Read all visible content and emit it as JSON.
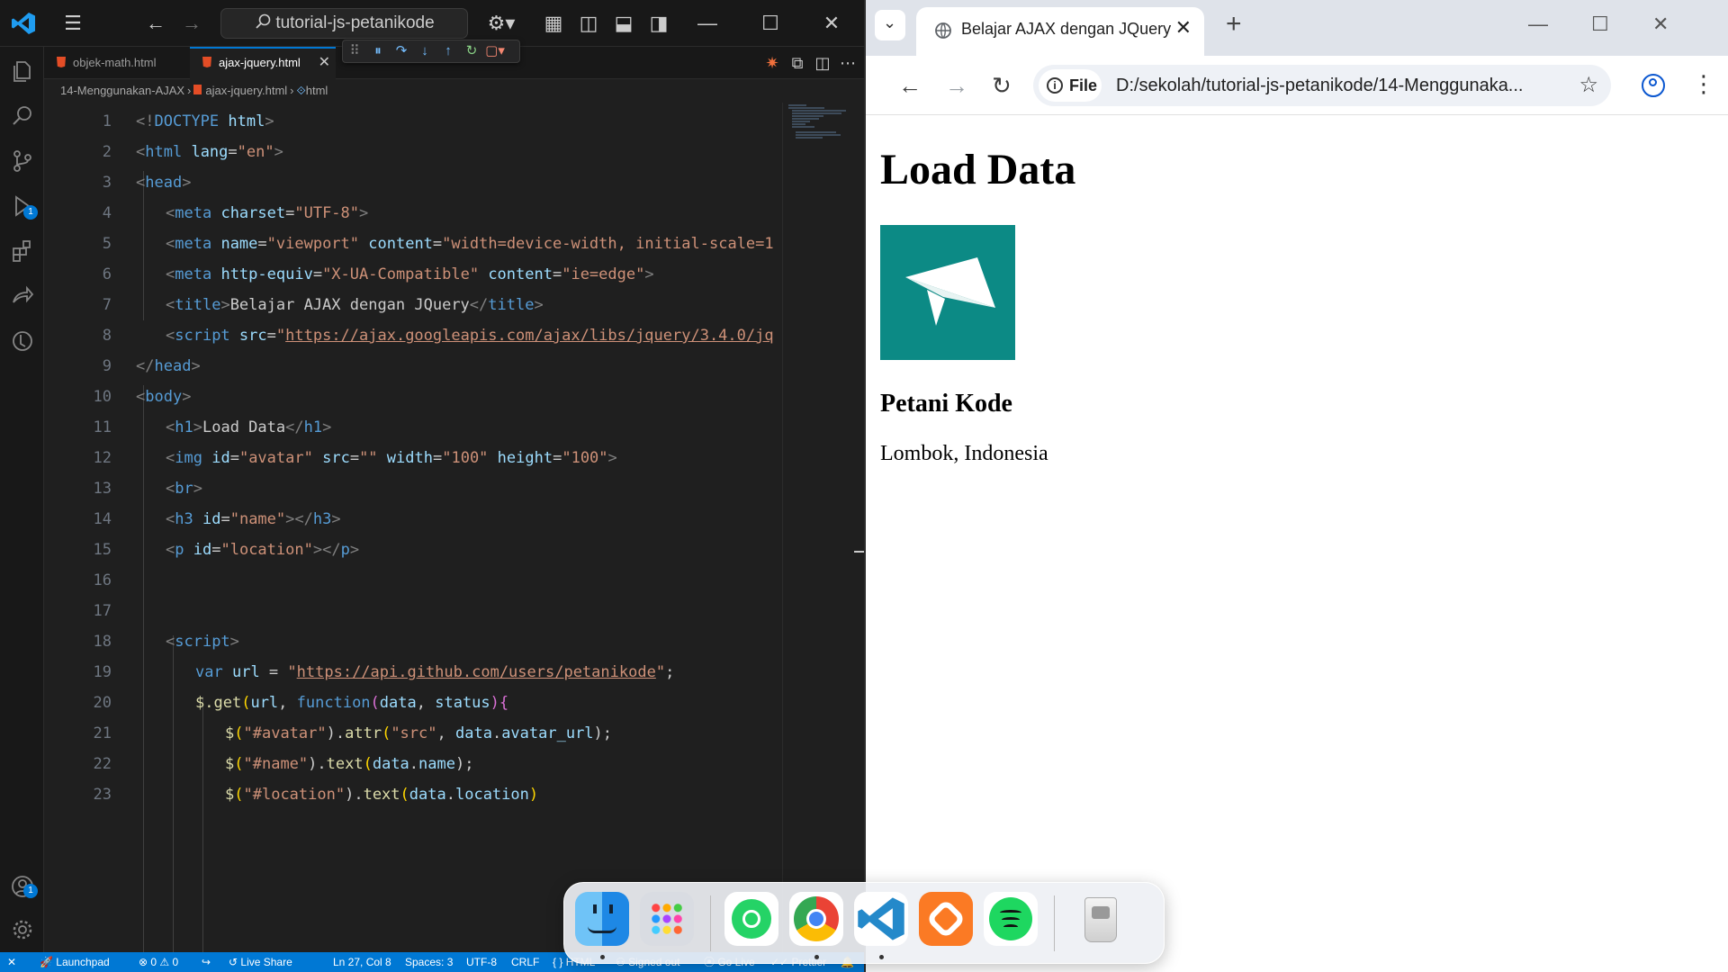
{
  "vscode": {
    "search_text": "tutorial-js-petanikode",
    "tabs": [
      {
        "label": "objek-math.html",
        "active": false
      },
      {
        "label": "ajax-jquery.html",
        "active": true
      }
    ],
    "breadcrumb": [
      "14-Menggunakan-AJAX",
      "ajax-jquery.html",
      "html"
    ],
    "activity_badges": {
      "run": "1",
      "accounts": "1"
    },
    "code_lines": [
      {
        "n": "1"
      },
      {
        "n": "2"
      },
      {
        "n": "3"
      },
      {
        "n": "4"
      },
      {
        "n": "5"
      },
      {
        "n": "6"
      },
      {
        "n": "7"
      },
      {
        "n": "8"
      },
      {
        "n": "9"
      },
      {
        "n": "10"
      },
      {
        "n": "11"
      },
      {
        "n": "12"
      },
      {
        "n": "13"
      },
      {
        "n": "14"
      },
      {
        "n": "15"
      },
      {
        "n": "16"
      },
      {
        "n": "17"
      },
      {
        "n": "18"
      },
      {
        "n": "19"
      },
      {
        "n": "20"
      },
      {
        "n": "21"
      },
      {
        "n": "22"
      },
      {
        "n": "23"
      }
    ],
    "code": {
      "l1": {
        "a": "<!",
        "b": "DOCTYPE",
        "c": "html",
        "d": ">"
      },
      "l2": {
        "a": "<",
        "b": "html",
        "c": "lang",
        "d": "=",
        "e": "\"en\"",
        "f": ">"
      },
      "l3": {
        "a": "<",
        "b": "head",
        "c": ">"
      },
      "l4": {
        "a": "<",
        "b": "meta",
        "c": "charset",
        "d": "=",
        "e": "\"UTF-8\"",
        "f": ">"
      },
      "l5": {
        "a": "<",
        "b": "meta",
        "c": "name",
        "d": "=",
        "e": "\"viewport\"",
        "f": "content",
        "g": "=",
        "h": "\"width=device-width, initial-scale=1"
      },
      "l6": {
        "a": "<",
        "b": "meta",
        "c": "http-equiv",
        "d": "=",
        "e": "\"X-UA-Compatible\"",
        "f": "content",
        "g": "=",
        "h": "\"ie=edge\"",
        "i": ">"
      },
      "l7": {
        "a": "<",
        "b": "title",
        "c": ">",
        "d": "Belajar AJAX dengan JQuery",
        "e": "</",
        "f": "title",
        "g": ">"
      },
      "l8": {
        "a": "<",
        "b": "script",
        "c": "src",
        "d": "=",
        "e": "\"",
        "f": "https://ajax.googleapis.com/ajax/libs/jquery/3.4.0/jq"
      },
      "l9": {
        "a": "</",
        "b": "head",
        "c": ">"
      },
      "l10": {
        "a": "<",
        "b": "body",
        "c": ">"
      },
      "l11": {
        "a": "<",
        "b": "h1",
        "c": ">",
        "d": "Load Data",
        "e": "</",
        "f": "h1",
        "g": ">"
      },
      "l12": {
        "a": "<",
        "b": "img",
        "c": "id",
        "d": "=",
        "e": "\"avatar\"",
        "f": "src",
        "g": "=",
        "h": "\"\"",
        "i": "width",
        "j": "=",
        "k": "\"100\"",
        "l": "height",
        "m": "=",
        "n": "\"100\"",
        "o": ">"
      },
      "l13": {
        "a": "<",
        "b": "br",
        "c": ">"
      },
      "l14": {
        "a": "<",
        "b": "h3",
        "c": "id",
        "d": "=",
        "e": "\"name\"",
        "f": "></",
        "g": "h3",
        "h": ">"
      },
      "l15": {
        "a": "<",
        "b": "p",
        "c": "id",
        "d": "=",
        "e": "\"location\"",
        "f": "></",
        "g": "p",
        "h": ">"
      },
      "l18": {
        "a": "<",
        "b": "script",
        "c": ">"
      },
      "l19": {
        "a": "var",
        "b": "url",
        "c": " = ",
        "d": "\"",
        "e": "https://api.github.com/users/petanikode",
        "f": "\"",
        "g": ";"
      },
      "l20": {
        "a": "$",
        "b": ".get",
        "c": "(",
        "d": "url",
        "e": ", ",
        "f": "function",
        "g": "(",
        "h": "data",
        "i": ", ",
        "j": "status",
        "k": "){"
      },
      "l21": {
        "a": "$",
        "b": "(",
        "c": "\"#avatar\"",
        "d": ").",
        "e": "attr",
        "f": "(",
        "g": "\"src\"",
        "h": ", ",
        "i": "data",
        "j": ".",
        "k": "avatar_url",
        "l": ");"
      },
      "l22": {
        "a": "$",
        "b": "(",
        "c": "\"#name\"",
        "d": ").",
        "e": "text",
        "f": "(",
        "g": "data",
        "h": ".",
        "i": "name",
        "j": ");"
      },
      "l23": {
        "a": "$",
        "b": "(",
        "c": "\"#location\"",
        "d": ").",
        "e": "text",
        "f": "(",
        "g": "data",
        "h": ".",
        "i": "location",
        "j": ")"
      }
    },
    "status": {
      "launchpad": "Launchpad",
      "problems": "0",
      "warnings": "0",
      "live_share": "Live Share",
      "cursor": "Ln 27, Col 8",
      "spaces": "Spaces: 3",
      "encoding": "UTF-8",
      "eol": "CRLF",
      "language": "HTML",
      "signed_out": "Signed out",
      "go_live": "Go Live",
      "prettier": "Prettier"
    },
    "colors": {
      "accent": "#0078d4",
      "editor_bg": "#1f1f1f"
    }
  },
  "chrome": {
    "tab_title": "Belajar AJAX dengan JQuery",
    "file_chip": "File",
    "url": "D:/sekolah/tutorial-js-petanikode/14-Menggunaka...",
    "page": {
      "heading": "Load Data",
      "name": "Petani Kode",
      "location": "Lombok, Indonesia",
      "avatar_color": "#0c8a85"
    }
  },
  "dock": {
    "apps": [
      "finder-icon",
      "launchpad-icon",
      "whatsapp-icon",
      "chrome-icon",
      "vscode-icon",
      "xampp-icon",
      "spotify-icon",
      "trash-icon"
    ]
  }
}
